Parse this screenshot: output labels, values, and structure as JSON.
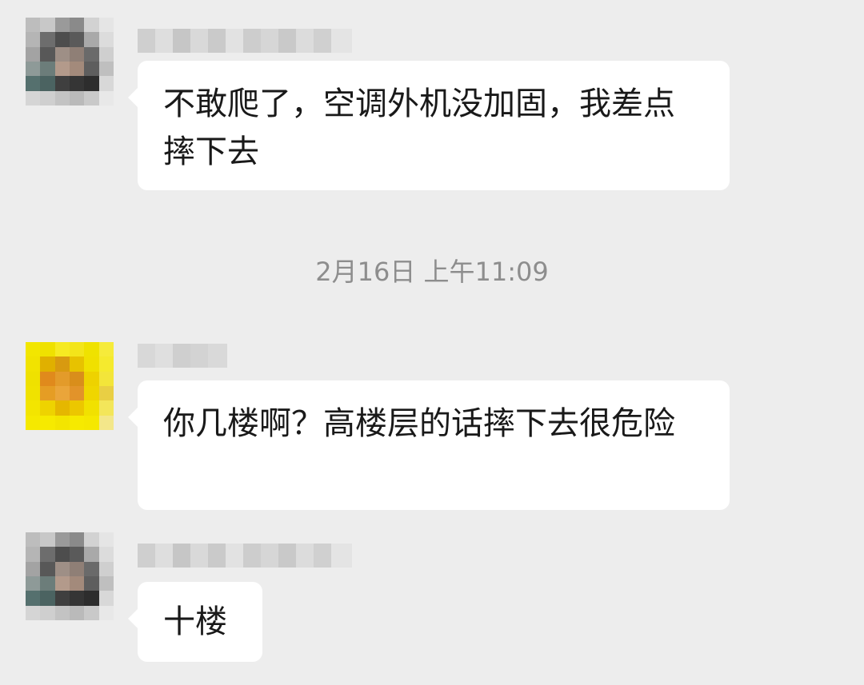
{
  "conversation": {
    "messages": [
      {
        "sender": "other",
        "text": "不敢爬了，空调外机没加固，我差点摔下去",
        "avatar_style": "person"
      },
      {
        "sender": "other",
        "text": "你几楼啊？高楼层的话摔下去很危险",
        "avatar_style": "yellow"
      },
      {
        "sender": "other",
        "text": "十楼",
        "avatar_style": "person"
      }
    ],
    "timestamp": "2月16日 上午11:09"
  },
  "colors": {
    "background": "#ededed",
    "bubble": "#ffffff",
    "text": "#191919",
    "timestamp": "#8d8d8d"
  }
}
